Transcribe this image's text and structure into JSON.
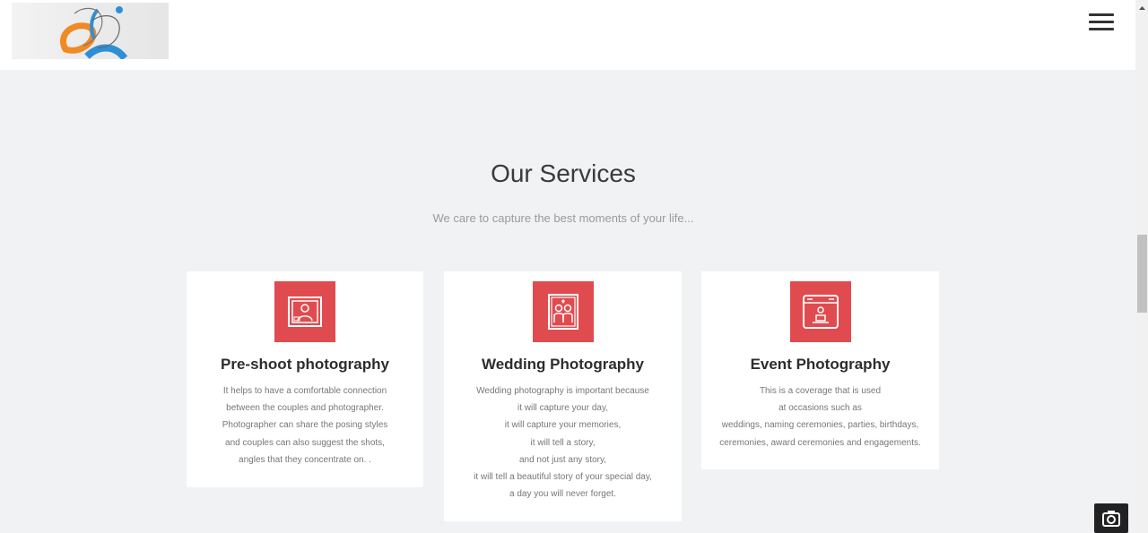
{
  "header": {
    "logo_alt": "logo",
    "menu_icon": "hamburger-menu-icon"
  },
  "services": {
    "title": "Our Services",
    "subtitle": "We care to capture the best moments of your life...",
    "cards": [
      {
        "icon": "photo-frame-icon",
        "title": "Pre-shoot photography",
        "lines": [
          "It helps to have a comfortable connection",
          "between the couples and photographer.",
          "Photographer can share the posing styles",
          "and couples can also suggest the shots,",
          "angles that they concentrate on. ."
        ]
      },
      {
        "icon": "couple-portrait-icon",
        "title": "Wedding Photography",
        "lines": [
          "Wedding photography is important because",
          "it will capture your day,",
          "it will capture your memories,",
          "it will tell a story,",
          "and not just any story,",
          "it will tell a beautiful story of your special day,",
          "a day you will never forget."
        ]
      },
      {
        "icon": "event-screen-icon",
        "title": "Event Photography",
        "lines": [
          "This is a coverage that is used",
          "at occasions such as",
          "weddings, naming ceremonies, parties, birthdays,",
          "ceremonies, award ceremonies and engagements."
        ]
      }
    ]
  },
  "colors": {
    "accent": "#e04b4f",
    "background": "#f1f2f4",
    "card": "#ffffff"
  },
  "floating": {
    "camera_icon": "camera-icon"
  }
}
